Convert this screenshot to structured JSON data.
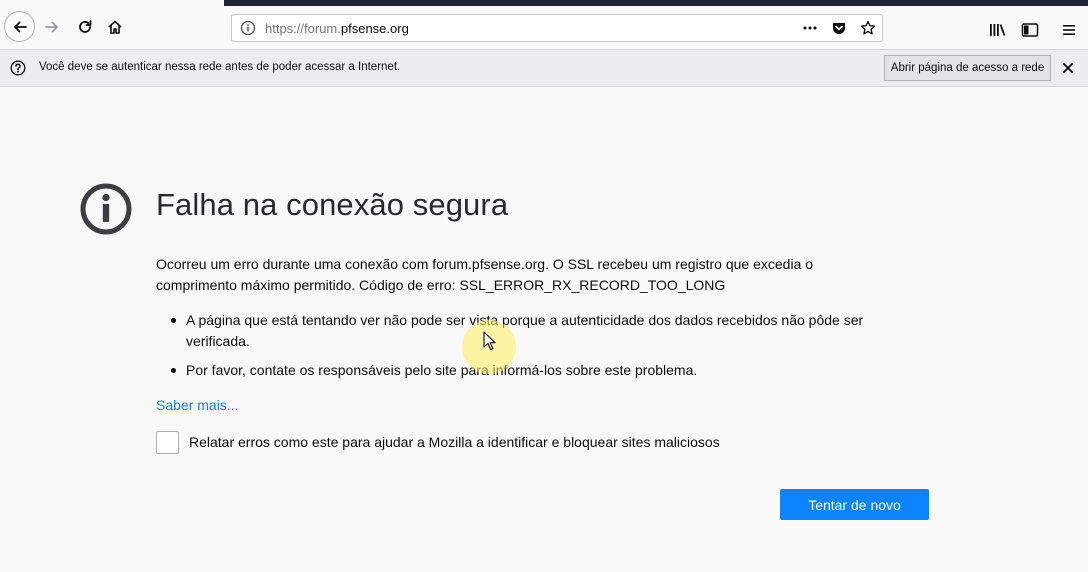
{
  "browser": {
    "url_prefix": "https://forum.",
    "url_domain": "pfsense.org",
    "icons": {
      "back": "back-arrow-icon",
      "forward": "forward-arrow-icon",
      "reload": "reload-icon",
      "home": "home-icon",
      "page_info": "info-icon",
      "page_actions": "more-dots-icon",
      "pocket": "pocket-icon",
      "bookmark": "star-icon",
      "library": "library-icon",
      "sidebar": "sidebar-icon",
      "menu": "hamburger-menu-icon"
    }
  },
  "notification": {
    "text": "Você deve se autenticar nessa rede antes de poder acessar a Internet.",
    "button_label": "Abrir página de acesso a rede"
  },
  "error_page": {
    "title": "Falha na conexão segura",
    "description": "Ocorreu um erro durante uma conexão com forum.pfsense.org. O SSL recebeu um registro que excedia o comprimento máximo permitido. Código de erro: SSL_ERROR_RX_RECORD_TOO_LONG",
    "bullets": [
      "A página que está tentando ver não pode ser vista porque a autenticidade dos dados recebidos não pôde ser verificada.",
      "Por favor, contate os responsáveis pelo site para informá-los sobre este problema."
    ],
    "learn_more": "Saber mais...",
    "report_label": "Relatar erros como este para ajudar a Mozilla a identificar e bloquear sites maliciosos",
    "report_checked": false,
    "retry_button": "Tentar de novo"
  },
  "colors": {
    "accent": "#0a84ff",
    "page_background": "#f9f9fa",
    "notification_background": "#ededf0",
    "title_text": "#2a2a2e"
  }
}
